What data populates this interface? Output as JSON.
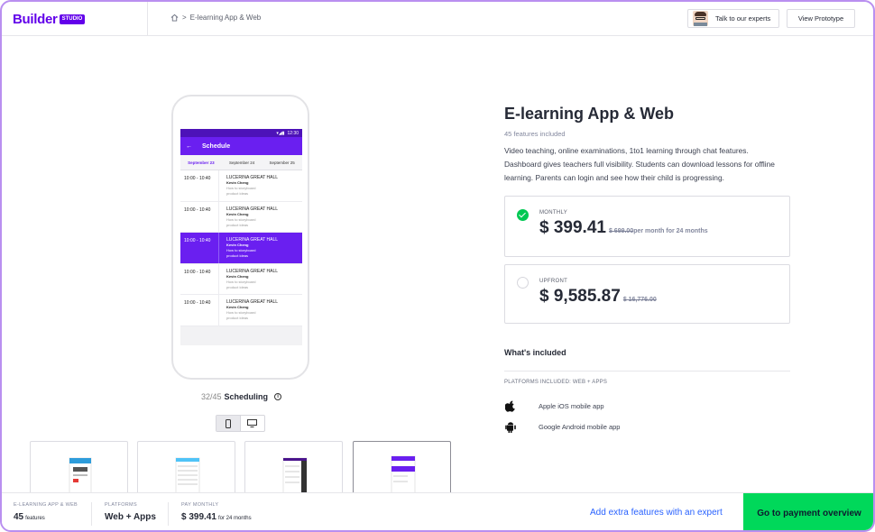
{
  "header": {
    "logo_text": "Builder",
    "logo_badge": "STUDIO",
    "breadcrumb_sep": ">",
    "breadcrumb_current": "E-learning App & Web",
    "expert_button": "Talk to our experts",
    "prototype_button": "View Prototype"
  },
  "phone": {
    "status_time": "12:30",
    "app_title": "Schedule",
    "dates": [
      "September 23",
      "September 24",
      "September 25"
    ],
    "rows": [
      {
        "time": "10:00 - 10:40",
        "title": "LUCERINA GREAT HALL",
        "name": "Kevin Cheng",
        "line1": "How to storyboard",
        "line2": "product ideas",
        "active": false
      },
      {
        "time": "10:00 - 10:40",
        "title": "LUCERINA GREAT HALL",
        "name": "Kevin Cheng",
        "line1": "How to storyboard",
        "line2": "product ideas",
        "active": false
      },
      {
        "time": "10:00 - 10:40",
        "title": "LUCERINA GREAT HALL",
        "name": "Kevin Cheng",
        "line1": "How to storyboard",
        "line2": "product ideas",
        "active": true
      },
      {
        "time": "10:00 - 10:40",
        "title": "LUCERINA GREAT HALL",
        "name": "Kevin Cheng",
        "line1": "How to storyboard",
        "line2": "product ideas",
        "active": false
      },
      {
        "time": "10:00 - 10:40",
        "title": "LUCERINA GREAT HALL",
        "name": "Kevin Cheng",
        "line1": "How to storyboard",
        "line2": "product ideas",
        "active": false
      }
    ]
  },
  "caption": {
    "count": "32/45",
    "feature": "Scheduling"
  },
  "product": {
    "title": "E-learning App & Web",
    "features_count": "45 features included",
    "description": "Video teaching, online examinations, 1to1 learning through chat features. Dashboard gives teachers full visibility. Students can download lessons for offline learning. Parents can login and see how their child is progressing."
  },
  "pricing": {
    "monthly": {
      "label": "MONTHLY",
      "price": "$ 399.41",
      "old_price": "$ 699.00",
      "note": "per month for 24 months",
      "selected": true
    },
    "upfront": {
      "label": "UPFRONT",
      "price": "$ 9,585.87",
      "old_price": "$ 16,776.00",
      "selected": false
    }
  },
  "included": {
    "heading": "What's included",
    "platforms_heading": "PLATFORMS INCLUDED: WEB + APPS",
    "platforms": [
      {
        "icon": "apple-icon",
        "label": "Apple iOS mobile app"
      },
      {
        "icon": "android-icon",
        "label": "Google Android mobile app"
      }
    ]
  },
  "footer": {
    "app_label": "E-LEARNING APP & WEB",
    "features_value": "45",
    "features_unit": "features",
    "platforms_label": "PLATFORMS",
    "platforms_value": "Web + Apps",
    "pay_label": "PAY MONTHLY",
    "pay_value": "$ 399.41",
    "pay_unit": "for 24 months",
    "add_link": "Add extra features with an expert",
    "pay_button": "Go to payment overview"
  },
  "colors": {
    "brand": "#6200ea",
    "success": "#00c853",
    "link": "#2962ff",
    "cta": "#00d85a"
  }
}
